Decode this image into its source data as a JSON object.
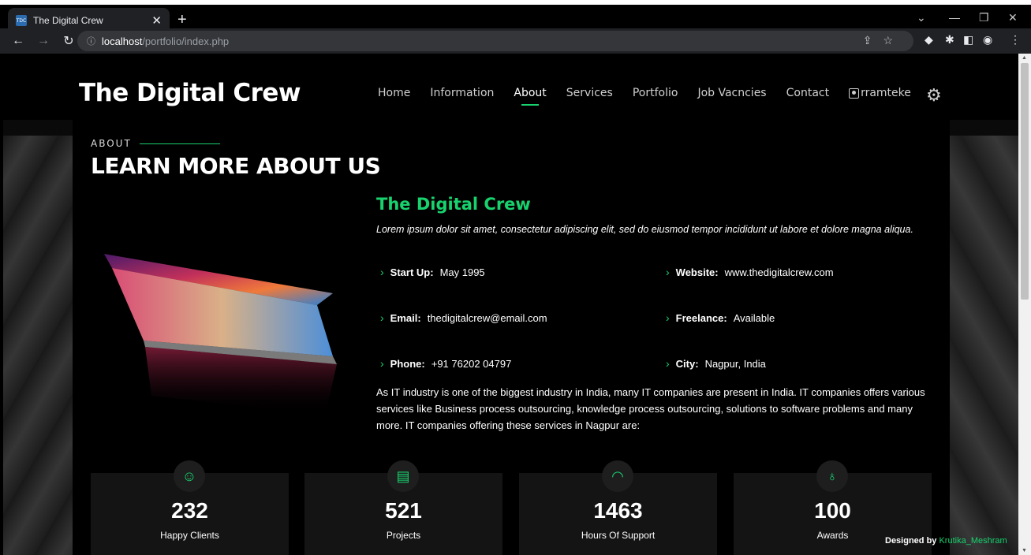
{
  "browser": {
    "tab_title": "The Digital Crew",
    "favicon_text": "TDC",
    "url_host": "localhost",
    "url_path": "/portfolio/index.php"
  },
  "site": {
    "logo": "The Digital Crew",
    "nav": [
      "Home",
      "Information",
      "About",
      "Services",
      "Portfolio",
      "Job Vacncies",
      "Contact"
    ],
    "active_nav": "About",
    "username": "rramteke"
  },
  "about": {
    "label": "ABOUT",
    "title": "LEARN MORE ABOUT US",
    "company": "The Digital Crew",
    "lead": "Lorem ipsum dolor sit amet, consectetur adipiscing elit, sed do eiusmod tempor incididunt ut labore et dolore magna aliqua.",
    "facts": [
      {
        "label": "Start Up:",
        "value": "May 1995"
      },
      {
        "label": "Website:",
        "value": "www.thedigitalcrew.com"
      },
      {
        "label": "Email:",
        "value": "thedigitalcrew@email.com"
      },
      {
        "label": "Freelance:",
        "value": "Available"
      },
      {
        "label": "Phone:",
        "value": "+91 76202 04797"
      },
      {
        "label": "City:",
        "value": "Nagpur, India"
      }
    ],
    "paragraph": "As IT industry is one of the biggest industry in India, many IT companies are present in India. IT companies offers various services like Business process outsourcing, knowledge process outsourcing, solutions to software problems and many more. IT companies offering these services in Nagpur are:"
  },
  "stats": [
    {
      "icon": "smile-icon",
      "value": "232",
      "label": "Happy Clients"
    },
    {
      "icon": "journal-icon",
      "value": "521",
      "label": "Projects"
    },
    {
      "icon": "headset-icon",
      "value": "1463",
      "label": "Hours Of Support"
    },
    {
      "icon": "award-icon",
      "value": "100",
      "label": "Awards"
    }
  ],
  "credit": {
    "prefix": "Designed by",
    "author": "Krutika_Meshram"
  },
  "colors": {
    "accent": "#18d26e",
    "background": "#000000"
  }
}
